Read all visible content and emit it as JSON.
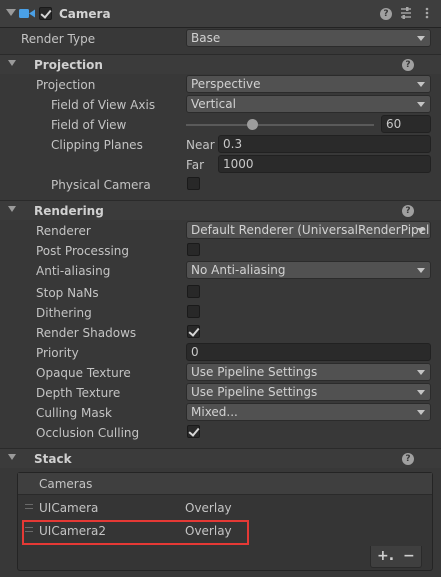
{
  "header": {
    "title": "Camera",
    "enabled": true,
    "colors": {
      "icon": "#4aa0e6"
    }
  },
  "render_type": {
    "label": "Render Type",
    "value": "Base"
  },
  "projection": {
    "section_title": "Projection",
    "projection": {
      "label": "Projection",
      "value": "Perspective"
    },
    "fov_axis": {
      "label": "Field of View Axis",
      "value": "Vertical"
    },
    "fov": {
      "label": "Field of View",
      "value": "60"
    },
    "clipping": {
      "label": "Clipping Planes",
      "near_label": "Near",
      "near_value": "0.3",
      "far_label": "Far",
      "far_value": "1000"
    },
    "physical_camera": {
      "label": "Physical Camera",
      "checked": false
    }
  },
  "rendering": {
    "section_title": "Rendering",
    "renderer": {
      "label": "Renderer",
      "value": "Default Renderer (UniversalRenderPipeli"
    },
    "post_processing": {
      "label": "Post Processing",
      "checked": false
    },
    "anti_aliasing": {
      "label": "Anti-aliasing",
      "value": "No Anti-aliasing"
    },
    "stop_nans": {
      "label": "Stop NaNs",
      "checked": false
    },
    "dithering": {
      "label": "Dithering",
      "checked": false
    },
    "render_shadows": {
      "label": "Render Shadows",
      "checked": true
    },
    "priority": {
      "label": "Priority",
      "value": "0"
    },
    "opaque_texture": {
      "label": "Opaque Texture",
      "value": "Use Pipeline Settings"
    },
    "depth_texture": {
      "label": "Depth Texture",
      "value": "Use Pipeline Settings"
    },
    "culling_mask": {
      "label": "Culling Mask",
      "value": "Mixed..."
    },
    "occlusion_culling": {
      "label": "Occlusion Culling",
      "checked": true
    }
  },
  "stack": {
    "section_title": "Stack",
    "list_title": "Cameras",
    "items": [
      {
        "name": "UICamera",
        "type": "Overlay"
      },
      {
        "name": "UICamera2",
        "type": "Overlay"
      }
    ],
    "add_label": "+.",
    "remove_label": "−",
    "colors": {
      "highlight": "#e53935"
    }
  }
}
